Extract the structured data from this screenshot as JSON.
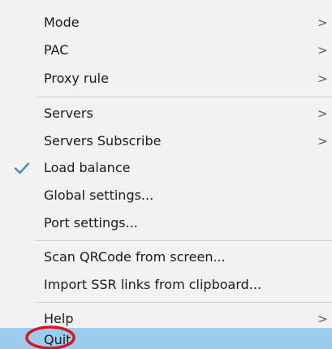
{
  "menu": {
    "items": [
      {
        "label": "Mode",
        "submenu": true
      },
      {
        "label": "PAC",
        "submenu": true
      },
      {
        "label": "Proxy rule",
        "submenu": true
      },
      {
        "label": "Servers",
        "submenu": true
      },
      {
        "label": "Servers Subscribe",
        "submenu": true
      },
      {
        "label": "Load balance",
        "checked": true
      },
      {
        "label": "Global settings..."
      },
      {
        "label": "Port settings..."
      },
      {
        "label": "Scan QRCode from screen..."
      },
      {
        "label": "Import SSR links from clipboard..."
      },
      {
        "label": "Help",
        "submenu": true
      },
      {
        "label": "Quit",
        "highlighted": true
      }
    ],
    "submenu_glyph": ">",
    "highlight_color": "#9ccbf0",
    "check_color": "#2f7fd6",
    "annotation_color": "#d8141c"
  }
}
